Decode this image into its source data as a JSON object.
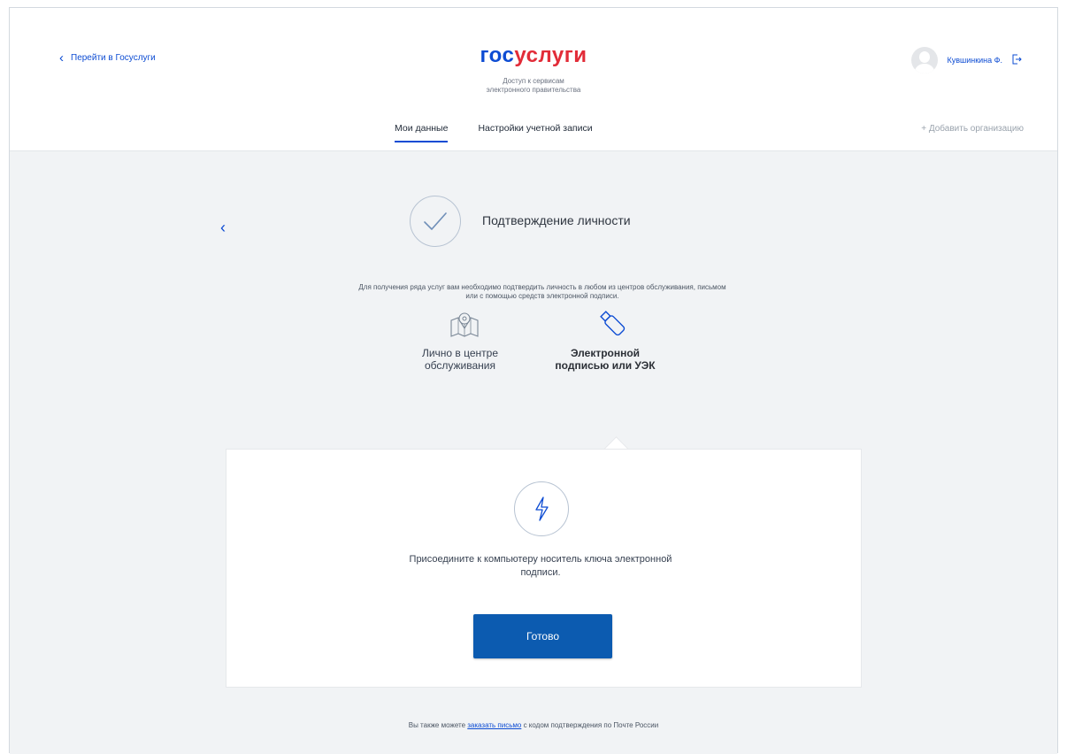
{
  "header": {
    "back_link": "Перейти в Госуслуги",
    "logo_part1": "гос",
    "logo_part2": "услуги",
    "tagline_line1": "Доступ к сервисам",
    "tagline_line2": "электронного правительства",
    "user_name": "Кувшинкина Ф.",
    "tabs": [
      {
        "label": "Мои данные",
        "active": true
      },
      {
        "label": "Настройки учетной записи",
        "active": false
      }
    ],
    "add_org": "+ Добавить организацию"
  },
  "content": {
    "step_title": "Подтверждение личности",
    "description_line1": "Для получения ряда услуг вам необходимо подтвердить личность в любом из центров обслуживания, письмом",
    "description_line2": "или с помощью средств электронной подписи.",
    "methods": [
      {
        "line1": "Лично в центре",
        "line2": "обслуживания",
        "icon": "map-pin-icon"
      },
      {
        "line1": "Электронной",
        "line2": "подписью или УЭК",
        "icon": "usb-key-icon"
      }
    ],
    "card_text_line1": "Присоедините к компьютеру носитель ключа электронной",
    "card_text_line2": "подписи.",
    "ready_button": "Готово",
    "footer_before": "Вы также можете",
    "footer_link": "заказать письмо",
    "footer_after": "с кодом подтверждения по Почте России"
  },
  "colors": {
    "brand_blue": "#0d4cd3",
    "brand_red": "#e22c38",
    "button_blue": "#0c5bb0",
    "background_gray": "#f1f3f5"
  }
}
